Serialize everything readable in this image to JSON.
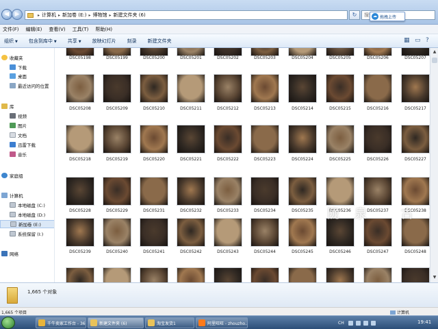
{
  "window": {
    "breadcrumbs": [
      "计算机",
      "新加卷 (E:)",
      "博物馆",
      "新建文件夹 (6)"
    ],
    "search_placeholder": "搜索",
    "popup_label": "拖拽上传"
  },
  "menu": [
    "文件(F)",
    "编辑(E)",
    "查看(V)",
    "工具(T)",
    "帮助(H)"
  ],
  "toolbar": [
    "组织",
    "包含到库中",
    "共享",
    "放映幻灯片",
    "刻录",
    "新建文件夹"
  ],
  "sidebar": [
    {
      "label": "收藏夹",
      "icon": "star-icon"
    },
    {
      "label": "下载",
      "icon": "download-icon"
    },
    {
      "label": "桌面",
      "icon": "desktop-icon"
    },
    {
      "label": "最近访问的位置",
      "icon": "recent-icon"
    },
    {
      "label": "库",
      "icon": "library-icon"
    },
    {
      "label": "视频",
      "icon": "video-icon"
    },
    {
      "label": "图片",
      "icon": "picture-icon"
    },
    {
      "label": "文档",
      "icon": "document-icon"
    },
    {
      "label": "迅雷下载",
      "icon": "thunder-icon"
    },
    {
      "label": "音乐",
      "icon": "music-icon"
    },
    {
      "label": "家庭组",
      "icon": "homegroup-icon"
    },
    {
      "label": "计算机",
      "icon": "computer-icon"
    },
    {
      "label": "本地磁盘 (C:)",
      "icon": "drive-icon"
    },
    {
      "label": "本地磁盘 (D:)",
      "icon": "drive-icon"
    },
    {
      "label": "新加卷 (E:)",
      "icon": "drive-icon",
      "selected": true
    },
    {
      "label": "系统保留 (I:)",
      "icon": "drive-icon"
    },
    {
      "label": "网络",
      "icon": "network-icon"
    }
  ],
  "files": {
    "rows": [
      [
        "DSC05198",
        "DSC05199",
        "DSC05200",
        "DSC05201",
        "DSC05202",
        "DSC05203",
        "DSC05204",
        "DSC05205",
        "DSC05206",
        "DSC05207"
      ],
      [
        "DSC05208",
        "DSC05209",
        "DSC05210",
        "DSC05211",
        "DSC05212",
        "DSC05213",
        "DSC05214",
        "DSC05215",
        "DSC05216",
        "DSC05217"
      ],
      [
        "DSC05218",
        "DSC05219",
        "DSC05220",
        "DSC05221",
        "DSC05222",
        "DSC05223",
        "DSC05224",
        "DSC05225",
        "DSC05226",
        "DSC05227"
      ],
      [
        "DSC05228",
        "DSC05229",
        "DSC05231",
        "DSC05232",
        "DSC05233",
        "DSC05234",
        "DSC05235",
        "DSC05236",
        "DSC05237",
        "DSC05238"
      ],
      [
        "DSC05239",
        "DSC05240",
        "DSC05241",
        "DSC05242",
        "DSC05243",
        "DSC05244",
        "DSC05245",
        "DSC05246",
        "DSC05247",
        "DSC05248"
      ],
      [
        "",
        "",
        "",
        "",
        "",
        "",
        "",
        "",
        "",
        ""
      ]
    ]
  },
  "watermark": "陇泉 古玉",
  "details": {
    "count": "1,665 个对象"
  },
  "status": {
    "left": "1,665 个项目",
    "right": "计算机"
  },
  "taskbar": {
    "tasks": [
      {
        "label": "千牛卖家工作台 - 36...",
        "icon": "chrome-icon"
      },
      {
        "label": "新建文件夹 (6)",
        "icon": "folder-icon",
        "active": true
      },
      {
        "label": "淘宝发货1",
        "icon": "folder-icon"
      },
      {
        "label": "阿里旺旺 - zhouzho...",
        "icon": "wangwang-icon"
      }
    ],
    "tray_lang": "CH",
    "clock": "19:41"
  }
}
